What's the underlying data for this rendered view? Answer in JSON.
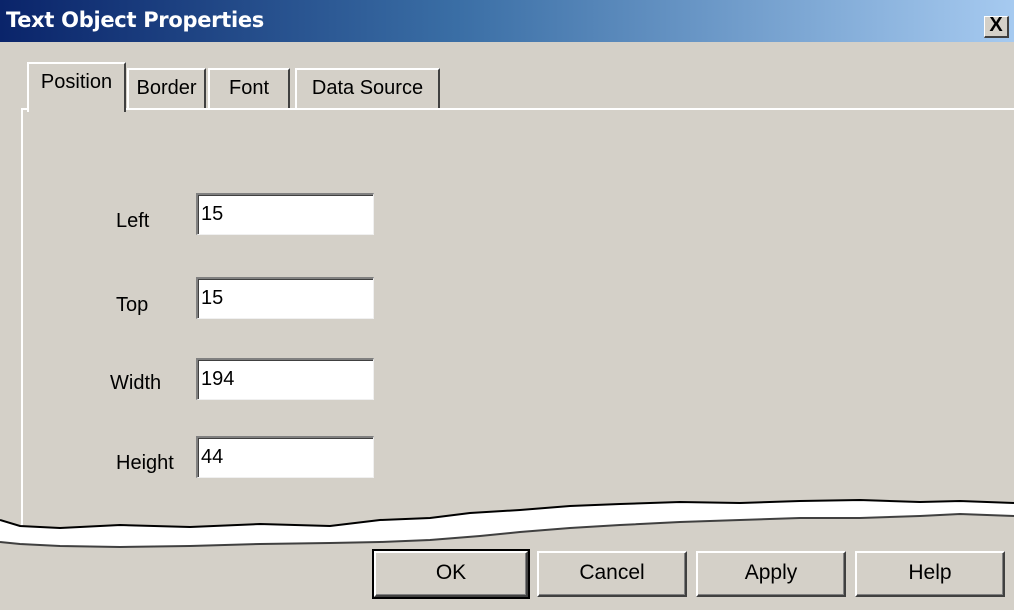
{
  "window": {
    "title": "Text Object Properties",
    "close_glyph": "X"
  },
  "tabs": [
    {
      "label": "Position",
      "active": true
    },
    {
      "label": "Border",
      "active": false
    },
    {
      "label": "Font",
      "active": false
    },
    {
      "label": "Data Source",
      "active": false
    }
  ],
  "fields": {
    "left": {
      "label": "Left",
      "value": "15"
    },
    "top": {
      "label": "Top",
      "value": "15"
    },
    "width": {
      "label": "Width",
      "value": "194"
    },
    "height": {
      "label": "Height",
      "value": "44"
    }
  },
  "buttons": {
    "ok": "OK",
    "cancel": "Cancel",
    "apply": "Apply",
    "help": "Help"
  },
  "colors": {
    "title_gradient_start": "#0a246a",
    "title_gradient_end": "#a6caf0",
    "dialog_face": "#d4d0c8"
  }
}
